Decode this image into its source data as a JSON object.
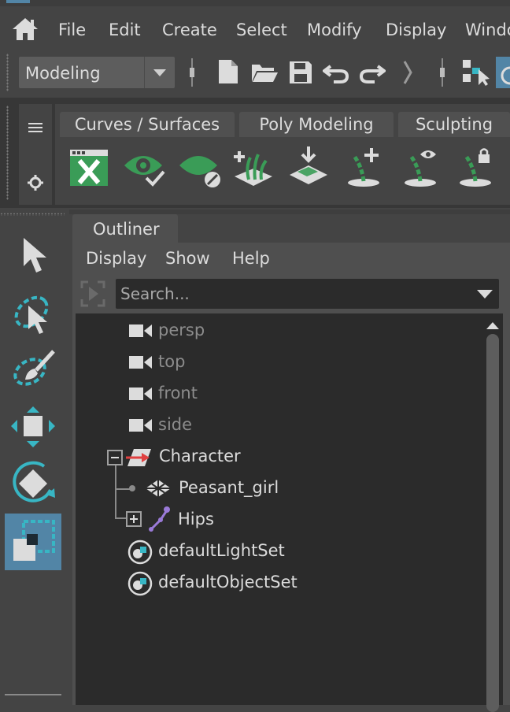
{
  "menubar": {
    "items": [
      "File",
      "Edit",
      "Create",
      "Select",
      "Modify",
      "Display",
      "Windo"
    ]
  },
  "statusline": {
    "mode_selected": "Modeling"
  },
  "shelf": {
    "tabs": [
      "Curves / Surfaces",
      "Poly Modeling",
      "Sculpting"
    ]
  },
  "outliner": {
    "tab_label": "Outliner",
    "menu": [
      "Display",
      "Show",
      "Help"
    ],
    "search_placeholder": "Search...",
    "items": [
      {
        "label": "persp",
        "icon": "camera-icon",
        "dimmed": true
      },
      {
        "label": "top",
        "icon": "camera-icon",
        "dimmed": true
      },
      {
        "label": "front",
        "icon": "camera-icon",
        "dimmed": true
      },
      {
        "label": "side",
        "icon": "camera-icon",
        "dimmed": true
      },
      {
        "label": "Character",
        "icon": "group-icon",
        "expanded": true,
        "dimmed": false
      },
      {
        "label": "Peasant_girl",
        "icon": "mesh-icon",
        "dimmed": false
      },
      {
        "label": "Hips",
        "icon": "joint-icon",
        "expanded": false,
        "dimmed": false
      },
      {
        "label": "defaultLightSet",
        "icon": "set-icon",
        "dimmed": false
      },
      {
        "label": "defaultObjectSet",
        "icon": "set-icon",
        "dimmed": false
      }
    ]
  },
  "colors": {
    "accent": "#5285a6",
    "shelf_green": "#3a9c57",
    "tool_cyan": "#38b6c4"
  }
}
